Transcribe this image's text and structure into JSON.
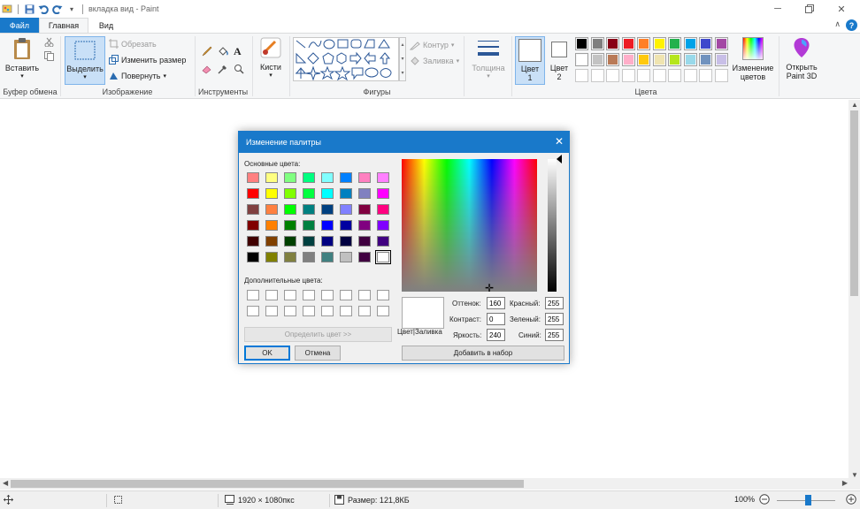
{
  "window": {
    "title": "вкладка вид - Paint"
  },
  "tabs": {
    "file": "Файл",
    "home": "Главная",
    "view": "Вид"
  },
  "ribbon": {
    "clipboard": {
      "group": "Буфер обмена",
      "paste": "Вставить"
    },
    "image": {
      "group": "Изображение",
      "select": "Выделить",
      "crop": "Обрезать",
      "resize": "Изменить размер",
      "rotate": "Повернуть"
    },
    "tools": {
      "group": "Инструменты"
    },
    "brushes": {
      "label": "Кисти"
    },
    "shapes": {
      "group": "Фигуры",
      "outline": "Контур",
      "fill": "Заливка"
    },
    "size": {
      "label": "Толщина"
    },
    "colors": {
      "group": "Цвета",
      "color1_line1": "Цвет",
      "color1_line2": "1",
      "color2_line1": "Цвет",
      "color2_line2": "2",
      "edit_line1": "Изменение",
      "edit_line2": "цветов",
      "palette_row1": [
        "#000000",
        "#7f7f7f",
        "#880015",
        "#ed1c24",
        "#ff7f27",
        "#fff200",
        "#22b14c",
        "#00a2e8",
        "#3f48cc",
        "#a349a4"
      ],
      "palette_row2": [
        "#ffffff",
        "#c3c3c3",
        "#b97a57",
        "#ffaec9",
        "#ffc90e",
        "#efe4b0",
        "#b5e61d",
        "#99d9ea",
        "#7092be",
        "#c8bfe7"
      ]
    },
    "paint3d": {
      "line1": "Открыть",
      "line2": "Paint 3D"
    }
  },
  "dialog": {
    "title": "Изменение палитры",
    "basic_colors_label": "Основные цвета:",
    "custom_colors_label": "Дополнительные цвета:",
    "define_button": "Определить цвет >>",
    "ok": "OK",
    "cancel": "Отмена",
    "preview_label": "Цвет|Заливка",
    "hue_label": "Оттенок:",
    "hue_value": "160",
    "sat_label": "Контраст:",
    "sat_value": "0",
    "lum_label": "Яркость:",
    "lum_value": "240",
    "red_label": "Красный:",
    "red_value": "255",
    "green_label": "Зеленый:",
    "green_value": "255",
    "blue_label": "Синий:",
    "blue_value": "255",
    "add_button": "Добавить в набор",
    "basic_colors": [
      "#ff8080",
      "#ffff80",
      "#80ff80",
      "#00ff80",
      "#80ffff",
      "#0080ff",
      "#ff80c0",
      "#ff80ff",
      "#ff0000",
      "#ffff00",
      "#80ff00",
      "#00ff40",
      "#00ffff",
      "#0080c0",
      "#8080c0",
      "#ff00ff",
      "#804040",
      "#ff8040",
      "#00ff00",
      "#008080",
      "#004080",
      "#8080ff",
      "#800040",
      "#ff0080",
      "#800000",
      "#ff8000",
      "#008000",
      "#008040",
      "#0000ff",
      "#0000a0",
      "#800080",
      "#8000ff",
      "#400000",
      "#804000",
      "#004000",
      "#004040",
      "#000080",
      "#000040",
      "#400040",
      "#400080",
      "#000000",
      "#808000",
      "#808040",
      "#808080",
      "#408080",
      "#c0c0c0",
      "#400040",
      "#ffffff"
    ]
  },
  "status": {
    "dimensions": "1920 × 1080пкс",
    "size": "Размер: 121,8КБ",
    "zoom": "100%"
  }
}
